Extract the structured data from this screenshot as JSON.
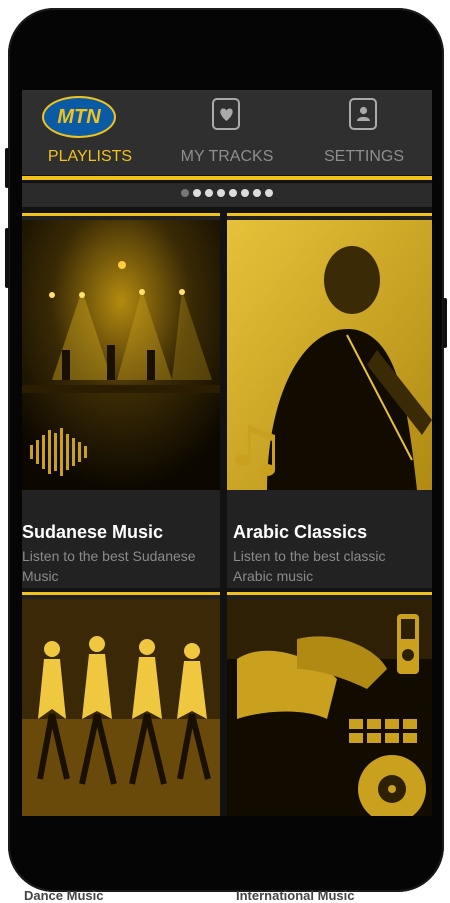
{
  "tabs": [
    {
      "label": "PLAYLISTS",
      "icon": "mtn-logo",
      "active": true
    },
    {
      "label": "MY TRACKS",
      "icon": "heart-card-icon",
      "active": false
    },
    {
      "label": "SETTINGS",
      "icon": "person-card-icon",
      "active": false
    }
  ],
  "logo_text": "MTN",
  "cards": [
    {
      "title": "Sudanese Music",
      "description": "Listen to the best Sudanese Music",
      "icon": "soundwave-icon"
    },
    {
      "title": "Arabic Classics",
      "description": "Listen to the best classic Arabic music",
      "icon": "music-note-icon"
    },
    {
      "title": "Dance Music",
      "description": ""
    },
    {
      "title": "International Music",
      "description": ""
    }
  ],
  "pager": {
    "total": 8,
    "current": 0
  },
  "colors": {
    "accent": "#f2c21c",
    "background": "#121212",
    "card": "#222222",
    "logo_blue": "#0a5aa6"
  }
}
